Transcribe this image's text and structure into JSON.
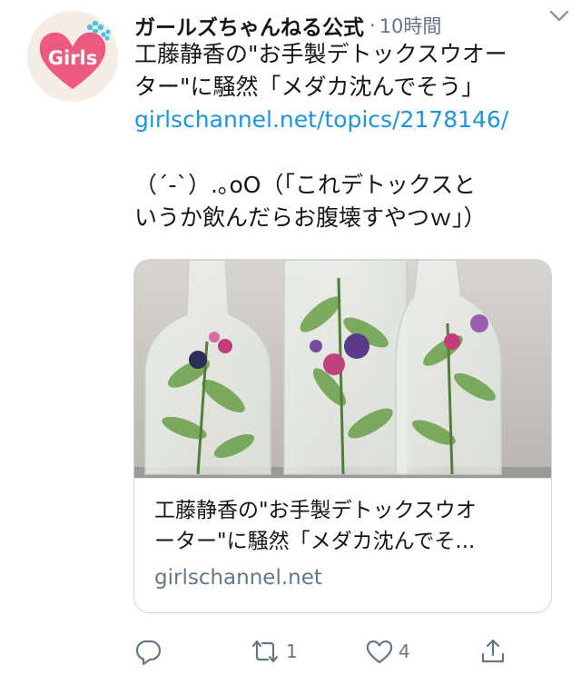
{
  "account": {
    "avatar_text": "Girls",
    "display_name": "ガールズちゃんねる公式",
    "separator": "·",
    "timestamp": "10時間"
  },
  "tweet": {
    "line1": "工藤静香の\"お手製デトックスウオー",
    "line2": "ター\"に騒然「メダカ沈んでそう」",
    "link": "girlschannel.net/topics/2178146/",
    "line4": "（´-`）.｡oO（「これデトックスと",
    "line5": "いうか飲んだらお腹壊すやつｗ」）"
  },
  "card": {
    "title_line1": "工藤静香の\"お手製デトックスウオ",
    "title_line2": "ーター\"に騒然「メダカ沈んでそ...",
    "domain": "girlschannel.net"
  },
  "actions": {
    "reply_count": "",
    "retweet_count": "1",
    "like_count": "4"
  },
  "colors": {
    "text": "#14171a",
    "muted": "#657786",
    "link": "#1b95e0",
    "avatar_heart": "#ec5b7e",
    "avatar_flower": "#4cc3e6"
  }
}
